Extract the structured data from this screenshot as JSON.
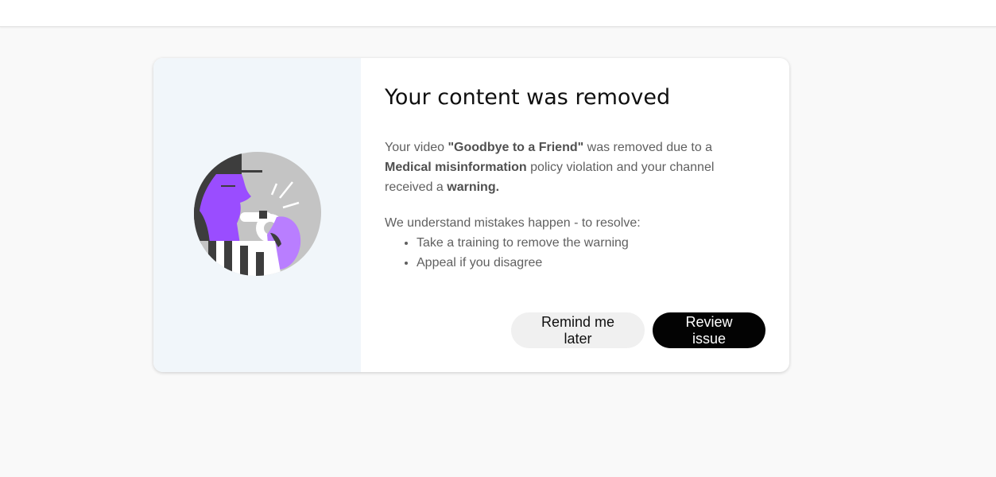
{
  "dialog": {
    "title": "Your content was removed",
    "description": {
      "part1": "Your video ",
      "video_title": "\"Goodbye to a Friend\"",
      "part2": " was removed due to a ",
      "policy": "Medical misinformation",
      "part3": " policy violation and your channel received a ",
      "strike": "warning."
    },
    "resolve_intro": "We understand mistakes happen - to resolve:",
    "steps": [
      "Take a training to remove the warning",
      "Appeal if you disagree"
    ],
    "buttons": {
      "remind_label": "Remind me later",
      "review_label": "Review issue"
    },
    "illustration": {
      "icon": "whistle-referee-illustration",
      "colors": {
        "purple": "#9747ff",
        "light_purple": "#b97eff",
        "gray": "#c2c2c2",
        "dark": "#3b3b3b",
        "panel_bg": "#f1f6fa"
      }
    }
  },
  "colors": {
    "page_bg": "#f9f9f9",
    "primary_button_bg": "#030303",
    "secondary_button_bg": "#f0f0f0"
  }
}
